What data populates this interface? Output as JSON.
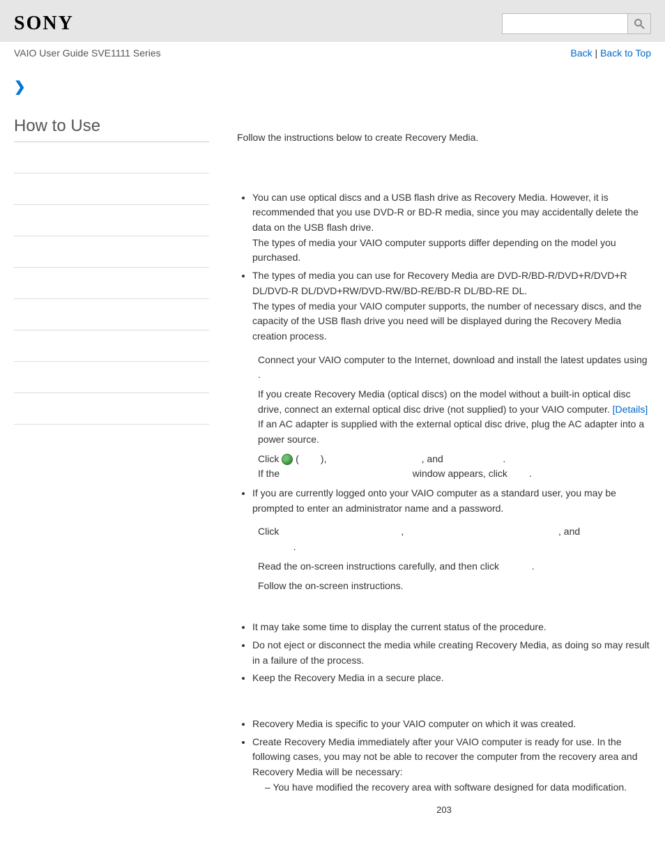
{
  "header": {
    "logo_text": "SONY",
    "breadcrumb": "VAIO User Guide SVE1111 Series",
    "back_label": "Back",
    "back_to_top_label": "Back to Top",
    "separator": " | ",
    "search_placeholder": ""
  },
  "sidebar": {
    "title": "How to Use"
  },
  "content": {
    "intro": "Follow the instructions below to create Recovery Media.",
    "bullets1": [
      "You can use optical discs and a USB flash drive as Recovery Media. However, it is recommended that you use DVD-R or BD-R media, since you may accidentally delete the data on the USB flash drive.\nThe types of media your VAIO computer supports differ depending on the model you purchased.",
      "The types of media you can use for Recovery Media are DVD-R/BD-R/DVD+R/DVD+R DL/DVD-R DL/DVD+RW/DVD-RW/BD-RE/BD-R DL/BD-RE DL.\nThe types of media your VAIO computer supports, the number of necessary discs, and the capacity of the USB flash drive you need will be displayed during the Recovery Media creation process."
    ],
    "step1_a": "Connect your VAIO computer to the Internet, download and install the latest updates using ",
    "step1_b": ".",
    "step2_a": "If you create Recovery Media (optical discs) on the model without a built-in optical disc drive, connect an external optical disc drive (not supplied) to your VAIO computer. ",
    "details_link": "[Details]",
    "step2_b": "If an AC adapter is supplied with the external optical disc drive, plug the AC adapter into a power source.",
    "step3_a": "Click ",
    "step3_b": " (",
    "step3_c": "), ",
    "step3_d": ", and ",
    "step3_e": ".",
    "step3_f": "If the ",
    "step3_g": " window appears, click ",
    "step3_h": ".",
    "note1": "If you are currently logged onto your VAIO computer as a standard user, you may be prompted to enter an administrator name and a password.",
    "step4_a": "Click ",
    "step4_b": ", ",
    "step4_c": ", and ",
    "step4_d": ".",
    "step5_a": "Read the on-screen instructions carefully, and then click ",
    "step5_b": ".",
    "step6": "Follow the on-screen instructions.",
    "bullets2": [
      "It may take some time to display the current status of the procedure.",
      "Do not eject or disconnect the media while creating Recovery Media, as doing so may result in a failure of the process.",
      "Keep the Recovery Media in a secure place."
    ],
    "bullets3_item1": "Recovery Media is specific to your VAIO computer on which it was created.",
    "bullets3_item2": "Create Recovery Media immediately after your VAIO computer is ready for use. In the following cases, you may not be able to recover the computer from the recovery area and Recovery Media will be necessary:",
    "sub_dash": "You have modified the recovery area with software designed for data modification.",
    "page_number": "203"
  }
}
